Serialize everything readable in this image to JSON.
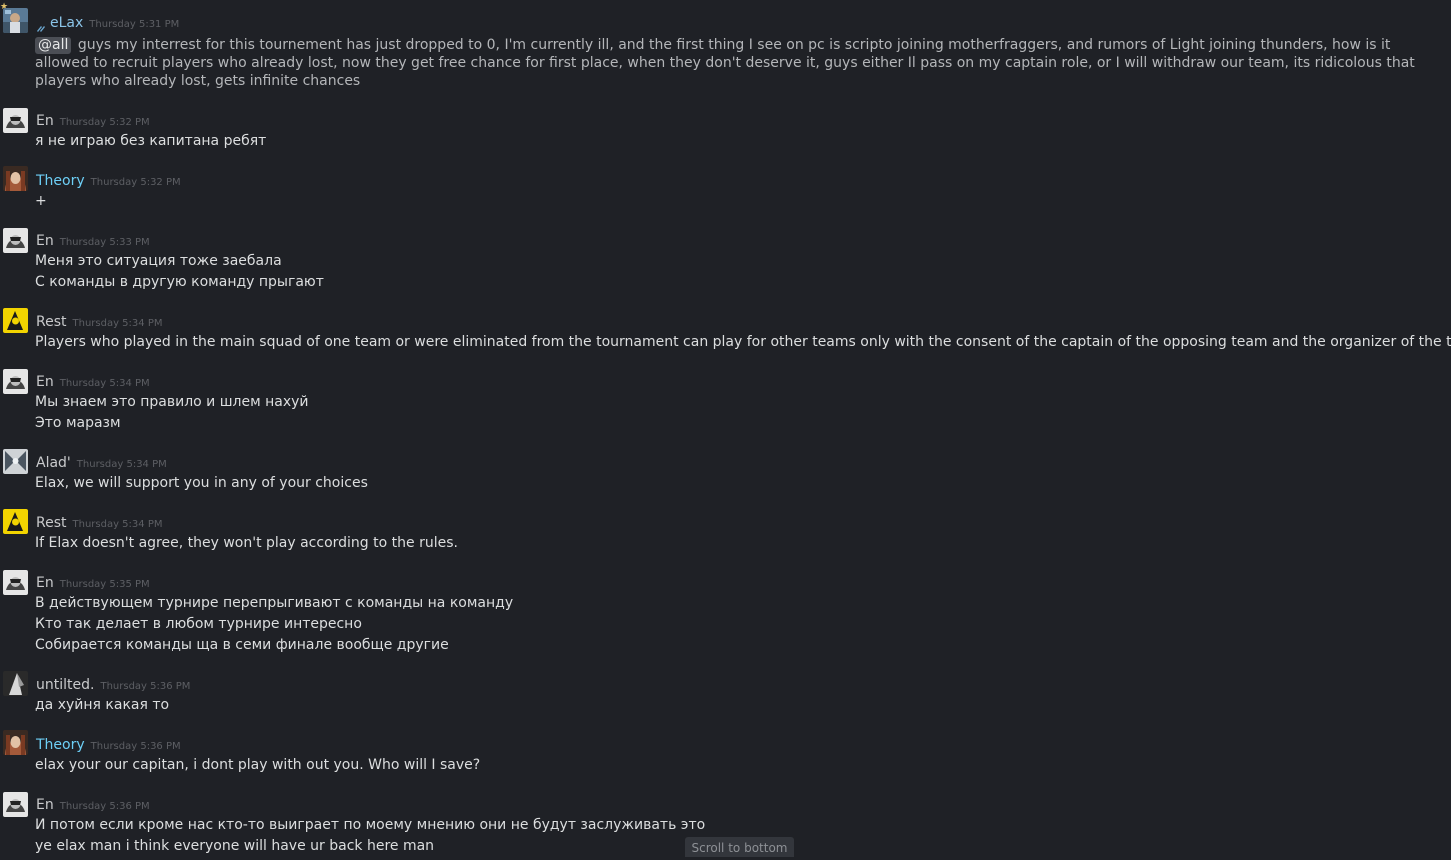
{
  "colors": {
    "background": "#1f2126",
    "name_default": "#c9cacc",
    "name_blue": "#6dcff6",
    "timestamp": "#5d5f64",
    "text": "#dcdedf"
  },
  "messages": [
    {
      "user": "eLax",
      "time": "Thursday 5:31 PM",
      "mention": "@all",
      "text": "guys my interrest for this tournement has just dropped to 0, I'm currently ill, and the first thing I see on pc is scripto joining motherfraggers, and rumors of Light joining thunders, how is it allowed to recruit players who already lost, now they get free chance for first place, when they don't deserve it, guys either Il pass on my captain role, or I will withdraw our team, its ridicolous that players who already lost, gets infinite chances"
    },
    {
      "user": "En",
      "time": "Thursday 5:32 PM",
      "lines": [
        "я не играю без капитана ребят"
      ]
    },
    {
      "user": "Theory",
      "time": "Thursday 5:32 PM",
      "lines": [
        "+"
      ]
    },
    {
      "user": "En",
      "time": "Thursday 5:33 PM",
      "lines": [
        "Меня это ситуация тоже заебала",
        "С команды в другую команду прыгают"
      ]
    },
    {
      "user": "Rest",
      "time": "Thursday 5:34 PM",
      "lines": [
        "Players who played in the main squad of one team or were eliminated from the tournament can play for other teams only with the consent of the captain of the opposing team and the organizer of the tournament."
      ]
    },
    {
      "user": "En",
      "time": "Thursday 5:34 PM",
      "lines": [
        "Мы знаем это правило и шлем нахуй",
        "Это маразм"
      ]
    },
    {
      "user": "Alad'",
      "time": "Thursday 5:34 PM",
      "lines": [
        "Elax, we will support you in any of your choices"
      ]
    },
    {
      "user": "Rest",
      "time": "Thursday 5:34 PM",
      "lines": [
        "If Elax doesn't agree, they won't play according to the rules."
      ]
    },
    {
      "user": "En",
      "time": "Thursday 5:35 PM",
      "lines": [
        "В действующем турнире перепрыгивают с команды на команду",
        "Кто так делает в любом турнире интересно",
        "Собирается команды ща в семи финале вообще другие"
      ]
    },
    {
      "user": "untilted.",
      "time": "Thursday 5:36 PM",
      "lines": [
        "да хуйня какая то"
      ]
    },
    {
      "user": "Theory",
      "time": "Thursday 5:36 PM",
      "lines": [
        "elax your our capitan, i dont play with out you. Who will I save?"
      ]
    },
    {
      "user": "En",
      "time": "Thursday 5:36 PM",
      "lines": [
        "И потом если кроме нас кто-то выиграет по моему мнению они не будут заслуживать это",
        "ye elax man i think everyone will have ur back here man"
      ]
    }
  ],
  "scroll_button": "Scroll to bottom"
}
